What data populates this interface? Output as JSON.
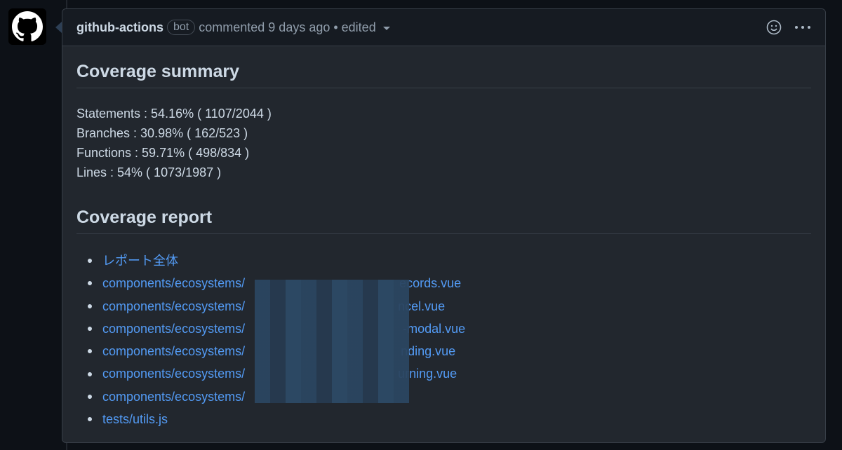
{
  "comment": {
    "author": "github-actions",
    "badge": "bot",
    "meta": "commented 9 days ago • edited",
    "icons": {
      "avatar": "github-logo-icon",
      "reaction": "smiley-icon",
      "menu": "kebab-horizontal-icon",
      "caret": "caret-down-icon"
    }
  },
  "summary": {
    "title": "Coverage summary",
    "lines": [
      "Statements : 54.16% ( 1107/2044 )",
      "Branches : 30.98% ( 162/523 )",
      "Functions : 59.71% ( 498/834 )",
      "Lines : 54% ( 1073/1987 )"
    ]
  },
  "report": {
    "title": "Coverage report",
    "links": [
      {
        "prefix": "レポート全体",
        "suffix": ""
      },
      {
        "prefix": "components/ecosystems/",
        "suffix": "ecords.vue"
      },
      {
        "prefix": "components/ecosystems/",
        "suffix": "ncel.vue"
      },
      {
        "prefix": "components/ecosystems/",
        "suffix": "-modal.vue"
      },
      {
        "prefix": "components/ecosystems/",
        "suffix": "nding.vue"
      },
      {
        "prefix": "components/ecosystems/",
        "suffix": "urning.vue"
      },
      {
        "prefix": "components/ecosystems/",
        "suffix": ""
      },
      {
        "prefix": "tests/utils.js",
        "suffix": ""
      }
    ]
  },
  "colors": {
    "link": "#539bf5",
    "background": "#22272e",
    "header": "#161b22"
  }
}
